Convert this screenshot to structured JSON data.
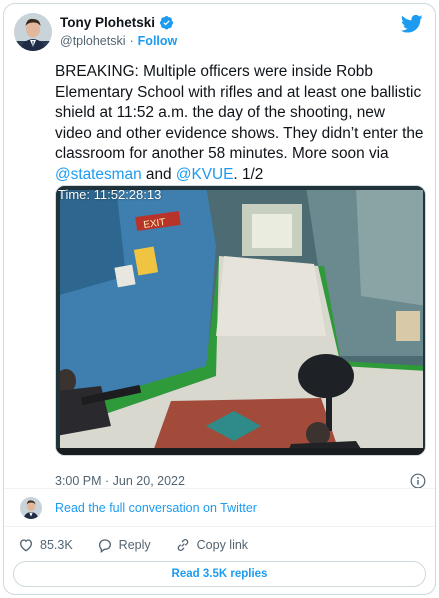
{
  "author": {
    "name": "Tony Plohetski",
    "handle": "@tplohetski",
    "separator": "·",
    "follow_label": "Follow"
  },
  "tweet": {
    "text_1": "BREAKING: Multiple officers were inside Robb Elementary School with rifles and at least one ballistic shield at 11:52 a.m. the day of the shooting, new video and other evidence shows. They didn’t enter the classroom for another 58 minutes. More soon via ",
    "mention_1": "@statesman",
    "text_2": " and ",
    "mention_2": "@KVUE",
    "text_3": ". 1/2"
  },
  "media": {
    "timestamp_overlay": "Time: 11:52:28:13",
    "sign_text": "EXIT"
  },
  "meta": {
    "posted": "3:00 PM · Jun 20, 2022"
  },
  "conversation": {
    "link_label": "Read the full conversation on Twitter"
  },
  "actions": {
    "likes": "85.3K",
    "reply_label": "Reply",
    "copy_link_label": "Copy link"
  },
  "read_replies_label": "Read 3.5K replies",
  "colors": {
    "accent": "#1d9bf0",
    "like_icon": "#536471",
    "text_primary": "#0f1419",
    "text_secondary": "#536471",
    "border": "#cfd9de"
  }
}
